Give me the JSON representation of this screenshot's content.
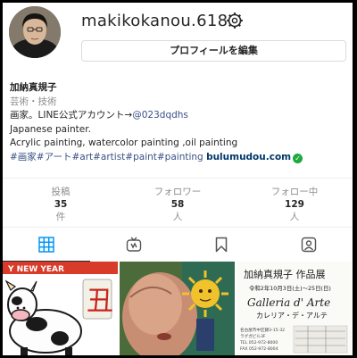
{
  "profile": {
    "username": "makikokanou.618",
    "edit_label": "プロフィールを編集",
    "name": "加納真規子",
    "category": "芸術・技術",
    "bio_line1_prefix": "画家。LINE公式アカウント→",
    "bio_line1_link": "@023dqdhs",
    "bio_line2": "Japanese painter.",
    "bio_line3": "Acrylic painting, watercolor painting ,oil painting",
    "hashtags": "#画家#アート#art#artist#paint#painting",
    "website": "bulumudou.com",
    "verified_glyph": "✓"
  },
  "stats": {
    "posts": {
      "label": "投稿",
      "value": "35",
      "unit": "件"
    },
    "followers": {
      "label": "フォロワー",
      "value": "58",
      "unit": "人"
    },
    "following": {
      "label": "フォロー中",
      "value": "129",
      "unit": "人"
    }
  },
  "tabs": [
    {
      "icon": "grid-icon",
      "active": true
    },
    {
      "icon": "igtv-icon",
      "active": false
    },
    {
      "icon": "bookmark-icon",
      "active": false
    },
    {
      "icon": "tagged-icon",
      "active": false
    }
  ],
  "posts": {
    "post1": {
      "banner": "Y NEW YEAR",
      "kanji": "丑"
    },
    "post3": {
      "title": "加納真規子 作品展",
      "dates": "令和2年10月3日(土)～25日(日)",
      "venue": "Galleria d' Arte",
      "venue_kana": "カレリア・デ・アルテ",
      "address": "名古屋市中区錦3-15-32",
      "building": "ラグガビル3F",
      "tel": "TEL 052-972-8000",
      "fax": "FAX 052-972-8004"
    }
  },
  "colors": {
    "accent": "#385185",
    "link": "#00376b",
    "muted": "#8e8e8e",
    "verified": "#1fa83f"
  }
}
